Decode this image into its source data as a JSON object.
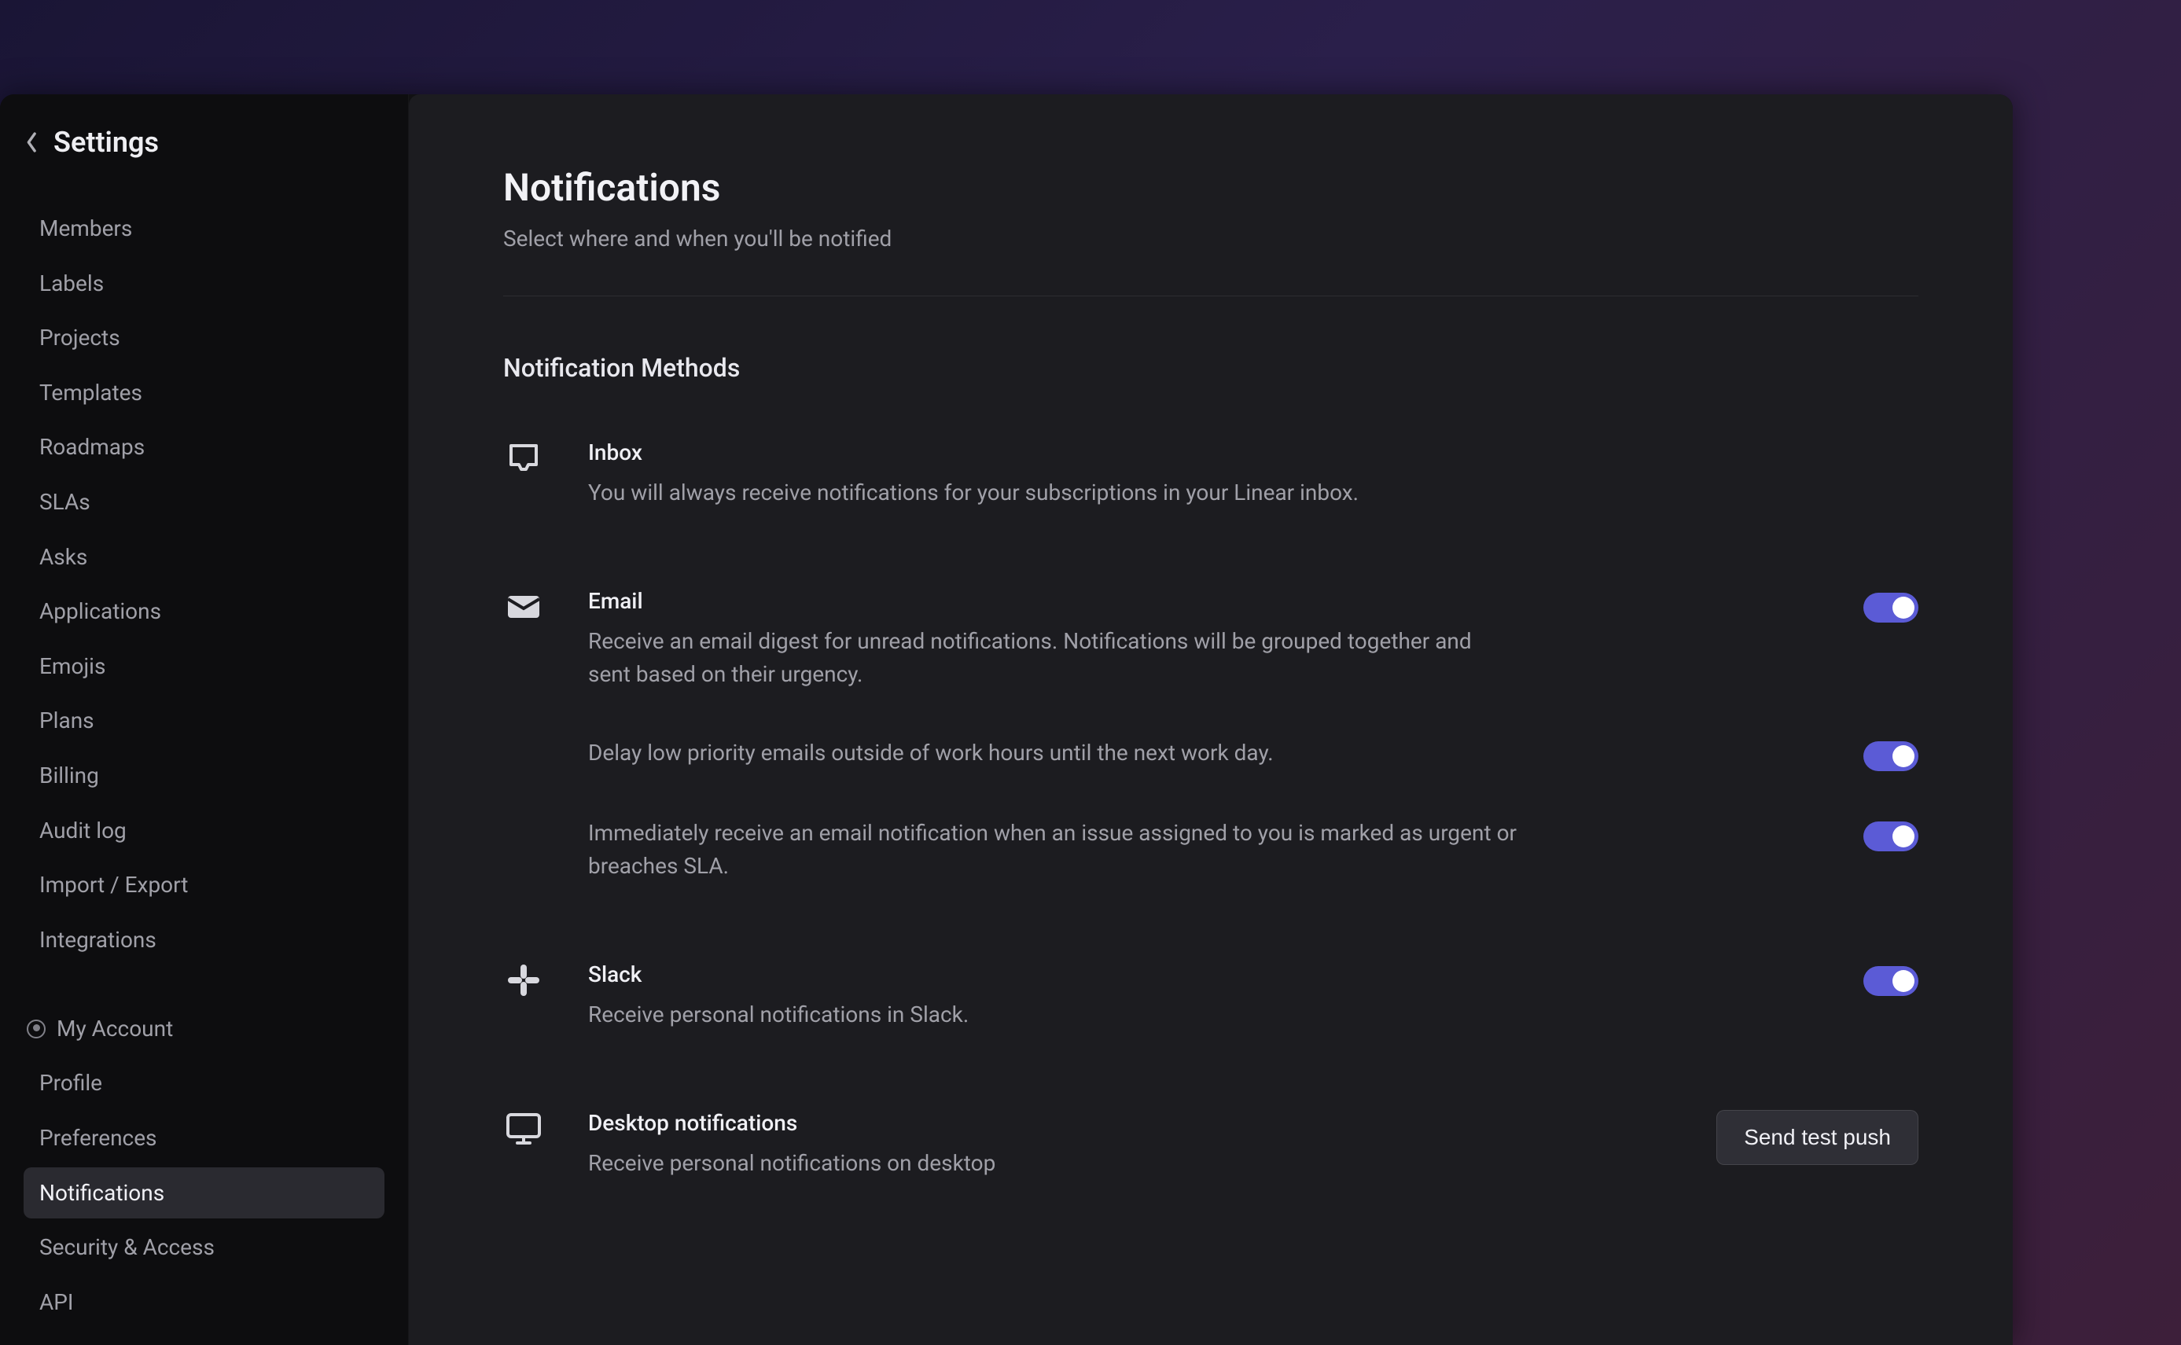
{
  "sidebar": {
    "title": "Settings",
    "workspace_items": [
      "Members",
      "Labels",
      "Projects",
      "Templates",
      "Roadmaps",
      "SLAs",
      "Asks",
      "Applications",
      "Emojis",
      "Plans",
      "Billing",
      "Audit log",
      "Import / Export",
      "Integrations"
    ],
    "account_section_label": "My Account",
    "account_items": [
      "Profile",
      "Preferences",
      "Notifications",
      "Security & Access",
      "API"
    ],
    "active_item": "Notifications"
  },
  "page": {
    "title": "Notifications",
    "subtitle": "Select where and when you'll be notified",
    "section_heading": "Notification Methods"
  },
  "methods": {
    "inbox": {
      "title": "Inbox",
      "desc": "You will always receive notifications for your subscriptions in your Linear inbox."
    },
    "email": {
      "title": "Email",
      "desc": "Receive an email digest for unread notifications. Notifications will be grouped together and sent based on their urgency.",
      "delay_desc": "Delay low priority emails outside of work hours until the next work day.",
      "urgent_desc": "Immediately receive an email notification when an issue assigned to you is marked as urgent or breaches SLA.",
      "digest_on": true,
      "delay_on": true,
      "urgent_on": true
    },
    "slack": {
      "title": "Slack",
      "desc": "Receive personal notifications in Slack.",
      "on": true
    },
    "desktop": {
      "title": "Desktop notifications",
      "desc": "Receive personal notifications on desktop",
      "button_label": "Send test push"
    }
  },
  "colors": {
    "accent": "#5b5bd6"
  }
}
